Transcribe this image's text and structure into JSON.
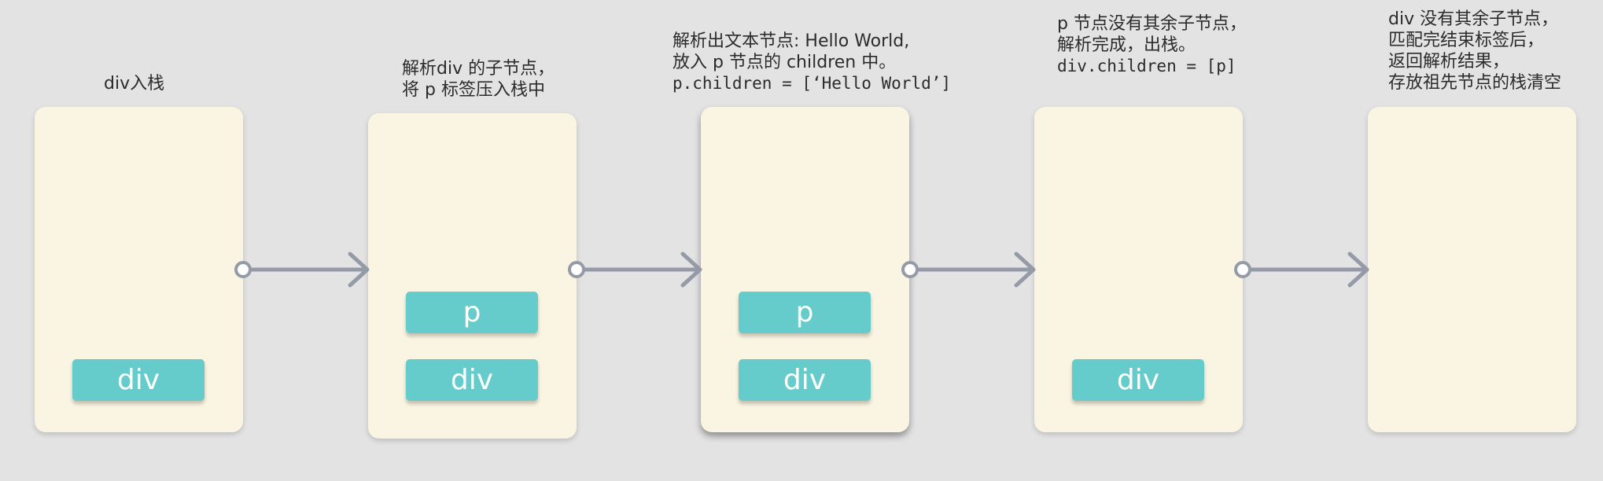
{
  "stages": [
    {
      "caption": [
        {
          "text": "div入栈",
          "mono": false
        }
      ],
      "nodes": [
        "div"
      ]
    },
    {
      "caption": [
        {
          "text": "解析div 的子节点，",
          "mono": false
        },
        {
          "text": "将 p 标签压入栈中",
          "mono": false
        }
      ],
      "nodes": [
        "p",
        "div"
      ]
    },
    {
      "caption": [
        {
          "text": "解析出文本节点: Hello World,",
          "mono": false
        },
        {
          "text": "放入 p 节点的 children 中。",
          "mono": false
        },
        {
          "text": "p.children = [‘Hello World’]",
          "mono": true
        }
      ],
      "nodes": [
        "p",
        "div"
      ]
    },
    {
      "caption": [
        {
          "text": "p 节点没有其余子节点，",
          "mono": false
        },
        {
          "text": "解析完成，出栈。",
          "mono": false
        },
        {
          "text": "div.children = [p]",
          "mono": true
        }
      ],
      "nodes": [
        "div"
      ]
    },
    {
      "caption": [
        {
          "text": "div 没有其余子节点，",
          "mono": false
        },
        {
          "text": "匹配完结束标签后，",
          "mono": false
        },
        {
          "text": "返回解析结果，",
          "mono": false
        },
        {
          "text": "存放祖先节点的栈清空",
          "mono": false
        }
      ],
      "nodes": []
    }
  ],
  "colors": {
    "background": "#e3e3e3",
    "stack": "#faf5e2",
    "node": "#66cccb",
    "arrow": "#949ba7"
  }
}
